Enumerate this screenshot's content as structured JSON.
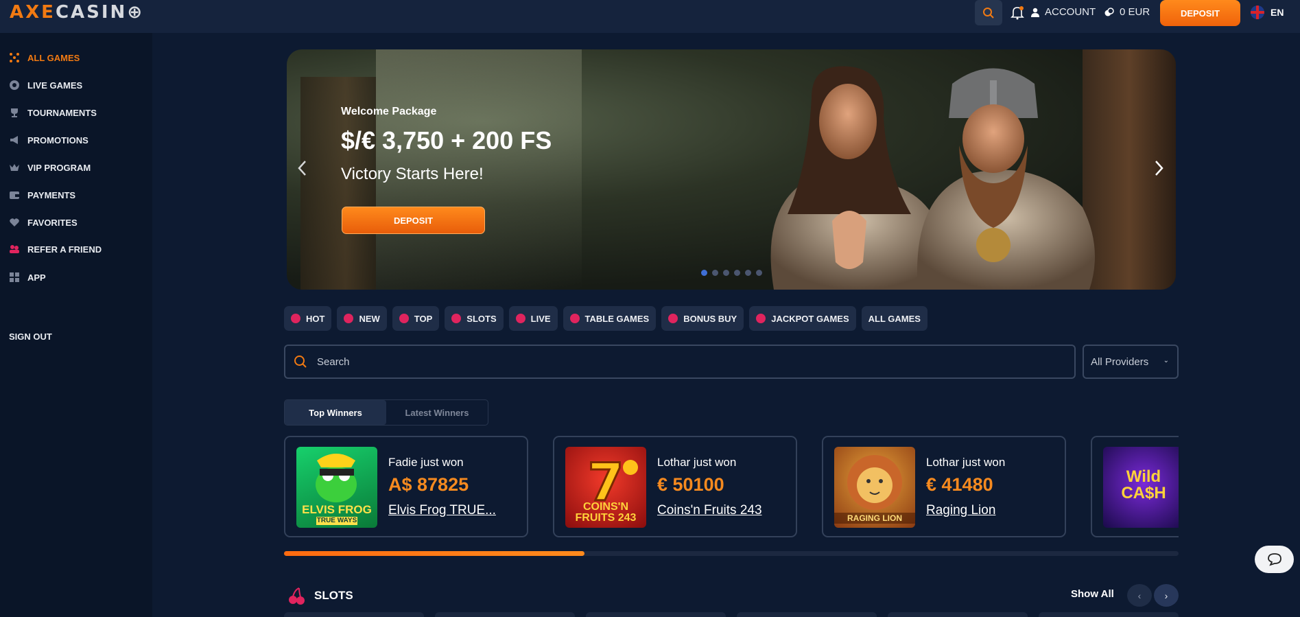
{
  "header": {
    "logo_axe": "AXE",
    "logo_casino": "CASIN",
    "account_label": "ACCOUNT",
    "balance": "0 EUR",
    "deposit_label": "DEPOSIT",
    "language": "EN"
  },
  "sidebar": {
    "items": [
      {
        "label": "ALL GAMES",
        "icon": "dice-icon",
        "active": true
      },
      {
        "label": "LIVE GAMES",
        "icon": "live-icon",
        "active": false
      },
      {
        "label": "TOURNAMENTS",
        "icon": "trophy-icon",
        "active": false
      },
      {
        "label": "PROMOTIONS",
        "icon": "megaphone-icon",
        "active": false
      },
      {
        "label": "VIP PROGRAM",
        "icon": "crown-icon",
        "active": false
      },
      {
        "label": "PAYMENTS",
        "icon": "wallet-icon",
        "active": false
      },
      {
        "label": "FAVORITES",
        "icon": "heart-icon",
        "active": false
      },
      {
        "label": "REFER A FRIEND",
        "icon": "friends-icon",
        "active": false
      },
      {
        "label": "APP",
        "icon": "apps-icon",
        "active": false
      }
    ],
    "sign_out": "SIGN OUT",
    "social": [
      "instagram-icon",
      "telegram-icon",
      "facebook-icon"
    ]
  },
  "banner": {
    "subtitle": "Welcome Package",
    "title": "$/€ 3,750 + 200 FS",
    "tagline": "Victory Starts Here!",
    "button": "DEPOSIT",
    "slides": 6,
    "active_slide": 1
  },
  "categories": [
    {
      "label": "HOT",
      "icon": "fire-icon"
    },
    {
      "label": "NEW",
      "icon": "new-icon"
    },
    {
      "label": "TOP",
      "icon": "top-icon"
    },
    {
      "label": "SLOTS",
      "icon": "cherry-icon"
    },
    {
      "label": "LIVE",
      "icon": "live-icon"
    },
    {
      "label": "TABLE GAMES",
      "icon": "dice-icon"
    },
    {
      "label": "BONUS BUY",
      "icon": "gift-icon"
    },
    {
      "label": "JACKPOT GAMES",
      "icon": "seven-icon"
    },
    {
      "label": "ALL GAMES",
      "icon": ""
    }
  ],
  "search": {
    "placeholder": "Search"
  },
  "providers": {
    "selected": "All Providers"
  },
  "winner_tabs": [
    "Top Winners",
    "Latest Winners"
  ],
  "winners": [
    {
      "who": "Fadie just won",
      "amount": "A$ 87825",
      "game": "Elvis Frog TRUE...",
      "thumb_text": "ELVIS FROG",
      "thumb_sub": "TRUE WAYS"
    },
    {
      "who": "Lothar just won",
      "amount": "€ 50100",
      "game": "Coins'n Fruits 243",
      "thumb_text": "COINS'N FRUITS 243",
      "thumb_sub": ""
    },
    {
      "who": "Lothar just won",
      "amount": "€ 41480",
      "game": "Raging Lion",
      "thumb_text": "RAGING LION",
      "thumb_sub": ""
    },
    {
      "who": "",
      "amount": "",
      "game": "",
      "thumb_text": "Wild CA$H",
      "thumb_sub": ""
    }
  ],
  "winners_progress": 0.336,
  "slots_section": {
    "title": "SLOTS",
    "show_all": "Show All"
  },
  "colors": {
    "accent": "#f27a12",
    "background": "#0d1a31",
    "sidebar": "#0a1528",
    "pink": "#e0245e"
  }
}
